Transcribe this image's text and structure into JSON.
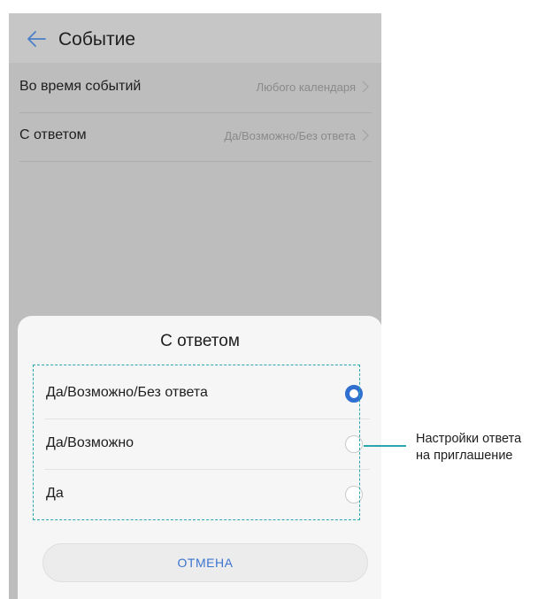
{
  "topbar": {
    "title": "Событие"
  },
  "settings": [
    {
      "label": "Во время событий",
      "value": "Любого календаря"
    },
    {
      "label": "С ответом",
      "value": "Да/Возможно/Без ответа"
    }
  ],
  "dialog": {
    "title": "С ответом",
    "options": [
      {
        "label": "Да/Возможно/Без ответа",
        "selected": true
      },
      {
        "label": "Да/Возможно",
        "selected": false
      },
      {
        "label": "Да",
        "selected": false
      }
    ],
    "cancel_label": "ОТМЕНА"
  },
  "callout": {
    "line1": "Настройки ответа",
    "line2": "на приглашение"
  },
  "colors": {
    "accent": "#2f6fcf",
    "highlight": "#2aa6b0"
  },
  "icons": [
    "back-arrow-icon",
    "chevron-right-icon"
  ]
}
